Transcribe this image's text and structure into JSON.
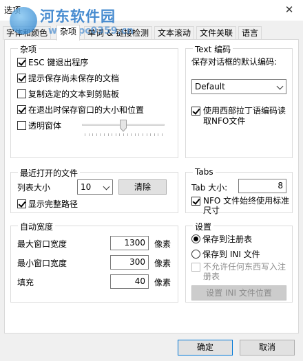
{
  "window": {
    "title": "选项",
    "close_glyph": "✕"
  },
  "watermark": {
    "title": "河东软件园",
    "url": "www.pc0359.cn"
  },
  "tabs": [
    {
      "label": "字体和颜色"
    },
    {
      "label": "杂项"
    },
    {
      "label": "单词 & 链接检测"
    },
    {
      "label": "文本滚动"
    },
    {
      "label": "文件关联"
    },
    {
      "label": "语言"
    }
  ],
  "misc": {
    "label": "杂项",
    "items": [
      {
        "label": "ESC 键退出程序",
        "checked": true
      },
      {
        "label": "提示保存尚未保存的文档",
        "checked": true
      },
      {
        "label": "复制选定的文本到剪贴板",
        "checked": false
      },
      {
        "label": "在退出时保存窗口的大小和位置",
        "checked": true
      },
      {
        "label": "透明窗体",
        "checked": false
      }
    ],
    "transparency_level": 0.5
  },
  "encoding": {
    "label": "Text 编码",
    "prompt": "保存对话框的默认编码:",
    "selected": "Default",
    "western_checkbox": "使用西部拉丁语编码读取NFO文件",
    "western_checked": true
  },
  "recent": {
    "label": "最近打开的文件",
    "list_size_label": "列表大小",
    "list_size_value": "10",
    "clear_button": "清除",
    "full_path_label": "显示完整路径",
    "full_path_checked": true
  },
  "tabs_group": {
    "label": "Tabs",
    "tab_size_label": "Tab 大小:",
    "tab_size_value": "8",
    "nfo_label": "NFO 文件始终使用标准尺寸",
    "nfo_checked": true
  },
  "autowidth": {
    "label": "自动宽度",
    "unit": "像素",
    "rows": [
      {
        "label": "最大窗口宽度",
        "value": "1300"
      },
      {
        "label": "最小窗口宽度",
        "value": "300"
      },
      {
        "label": "填充",
        "value": "40"
      }
    ]
  },
  "settings": {
    "label": "设置",
    "radio_registry": "保存到注册表",
    "radio_ini": "保存到 INI 文件",
    "selected": "registry",
    "no_write_label": "不允许任何东西写入注册表",
    "ini_location_button": "设置 INI 文件位置"
  },
  "footer": {
    "ok": "确定",
    "cancel": "取消"
  },
  "colors": {
    "accent": "#0078d7",
    "panel": "#ffffff",
    "window": "#f0f0f0"
  }
}
